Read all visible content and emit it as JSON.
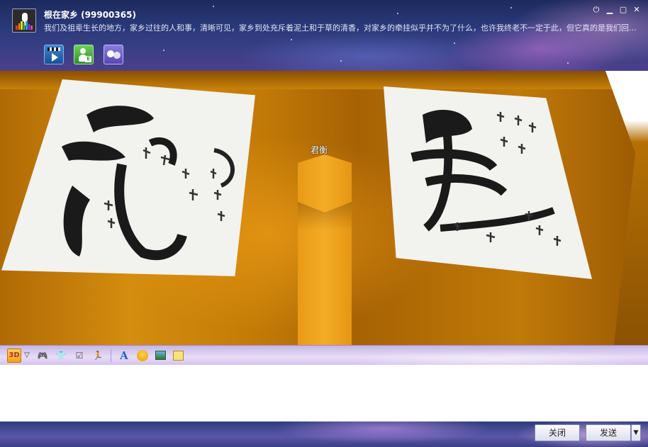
{
  "header": {
    "group_name": "根在家乡 (99900365)",
    "description": "我们及祖辈生长的地方，家乡过往的人和事，清晰可见，家乡到处充斥着泥土和于草的清香，对家乡的牵挂似乎并不为了什么，也许我终老不一定于此，但它真的是我们回忆...",
    "window_controls": [
      "power-icon",
      "minimize-icon",
      "maximize-icon",
      "close-icon"
    ]
  },
  "apps": [
    "video-icon",
    "user-card-icon",
    "chat-icon"
  ],
  "scene": {
    "avatar_name": "君衡"
  },
  "toolbar": {
    "mode_3d_label": "3D",
    "dropdown_glyph": "▽",
    "font_glyph": "A"
  },
  "footer": {
    "close_label": "关闭",
    "send_label": "发送",
    "send_options_glyph": "▼"
  }
}
